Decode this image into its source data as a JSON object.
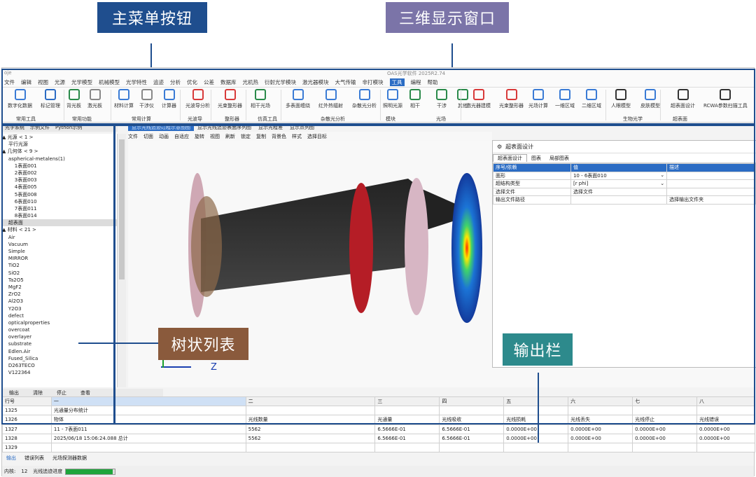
{
  "callouts": {
    "menu": "主菜单按钮",
    "view3d": "三维显示窗口",
    "tree": "树状列表",
    "output": "输出栏"
  },
  "window": {
    "app_icon": "oje",
    "title": "OAS光学软件 2025R2.74"
  },
  "menubar": [
    "文件",
    "编辑",
    "视图",
    "光源",
    "光学模型",
    "机械模型",
    "光学特性",
    "追迹",
    "分析",
    "优化",
    "公差",
    "数据库",
    "光机热",
    "衍射光学模块",
    "激光器模块",
    "大气传输",
    "非打模块",
    "工具",
    "编程",
    "帮助"
  ],
  "menubar_active": "工具",
  "ribbon": {
    "buttons": [
      "数字化数据",
      "标记管理",
      "背光板",
      "激光板",
      "材料计算",
      "干涉仪",
      "计算器",
      "光波导分析",
      "光束整形器",
      "相干光场",
      "多表面缠绕",
      "红外热辐射",
      "杂散光分析",
      "照明光源",
      "相干",
      "干涉",
      "其他",
      "激光器建模",
      "光束整形器",
      "光场计算",
      "一维区域",
      "二维区域",
      "人眼模型",
      "皮肤模型",
      "超表面设计",
      "RCWA参数扫描工具"
    ],
    "groups": [
      "常用工具",
      "常用功能",
      "常用计算",
      "光波导",
      "整形器",
      "仿真工具",
      "杂散光分析",
      "模块",
      "光场",
      "生物光学",
      "超表面"
    ]
  },
  "left_tabs": [
    "光学系统",
    "示例文件",
    "Python示例"
  ],
  "tree": [
    "▲ 光源 < 1 >",
    "    平行光源",
    "▲ 几何体 < 9 >",
    "    aspherical-metalens(1)",
    "        1表面001",
    "        2表面002",
    "        3表面003",
    "        4表面005",
    "        5表面008",
    "        6表面010",
    "        7表面011",
    "        8表面014",
    "    超表面",
    "▲ 材料 < 21 >",
    "    Air",
    "    Vacuum",
    "    Simple",
    "    MIRROR",
    "    TiO2",
    "    SiO2",
    "    Ta2O5",
    "    MgF2",
    "    ZrO2",
    "    Al2O3",
    "    Y2O3",
    "    defect",
    "    opticalproperties",
    "    overcoat",
    "    overlayer",
    "    substrate",
    "    Edlen.Air",
    "    Fused_Silica",
    "    D263TECO",
    "    V122364"
  ],
  "view_tabs": [
    "显示光线追迹过程示意图图",
    "显示光线追迹表面序列图",
    "显示光程差",
    "显示点列图"
  ],
  "view_toolbar": [
    "文件",
    "切面",
    "动画",
    "自适应",
    "旋转",
    "视图",
    "刷新",
    "锁定",
    "复制",
    "背景色",
    "样式",
    "选择目标"
  ],
  "axis": {
    "z": "Z"
  },
  "dialog": {
    "title": "超表面设计",
    "tabs": [
      "超表面设计",
      "图表",
      "局部图表"
    ],
    "headers": [
      "序号/依赖",
      "值",
      "描述"
    ],
    "rows": [
      {
        "k": "面形",
        "v": "10 - 6表面010",
        "d": ""
      },
      {
        "k": "超结构类型",
        "v": "[r phi]",
        "d": ""
      },
      {
        "k": "选择文件",
        "v": "选择文件",
        "d": ""
      },
      {
        "k": "输出文件路径",
        "v": "",
        "d": "选择输出文件夹"
      }
    ]
  },
  "output_tabs": [
    "输出",
    "清除",
    "停止",
    "查看"
  ],
  "output_table": {
    "headers": [
      "行号",
      "一",
      "二",
      "三",
      "四",
      "五",
      "六",
      "七",
      "八"
    ],
    "rows": [
      [
        "1325",
        "光通量分布统计",
        "",
        "",
        "",
        "",
        "",
        "",
        ""
      ],
      [
        "1326",
        "物体",
        "光线数量",
        "光通量",
        "光线吸收",
        "光线损耗",
        "光线丢失",
        "光线停止",
        "光线错误"
      ],
      [
        "1327",
        "11 - 7表面011",
        "5562",
        "6.5666E-01",
        "6.5666E-01",
        "0.0000E+00",
        "0.0000E+00",
        "0.0000E+00",
        "0.0000E+00"
      ],
      [
        "1328",
        "2025/06/18 15:06:24.088 总计",
        "5562",
        "6.5666E-01",
        "6.5666E-01",
        "0.0000E+00",
        "0.0000E+00",
        "0.0000E+00",
        "0.0000E+00"
      ],
      [
        "1329",
        "",
        "",
        "",
        "",
        "",
        "",
        "",
        ""
      ]
    ]
  },
  "bottom_tabs": [
    "输出",
    "错误列表",
    "光场探测器数据"
  ],
  "status": {
    "label": "内核:",
    "cores": "12",
    "progress_label": "光线追迹进度",
    "progress": 0.95
  },
  "colors": {
    "accent": "#2b6cc4",
    "menu_callout": "#1f4e8e",
    "view_callout": "#7b74a8",
    "tree_callout": "#8a5a3c",
    "output_callout": "#2d8a8c",
    "progress": "#1ea53b"
  }
}
